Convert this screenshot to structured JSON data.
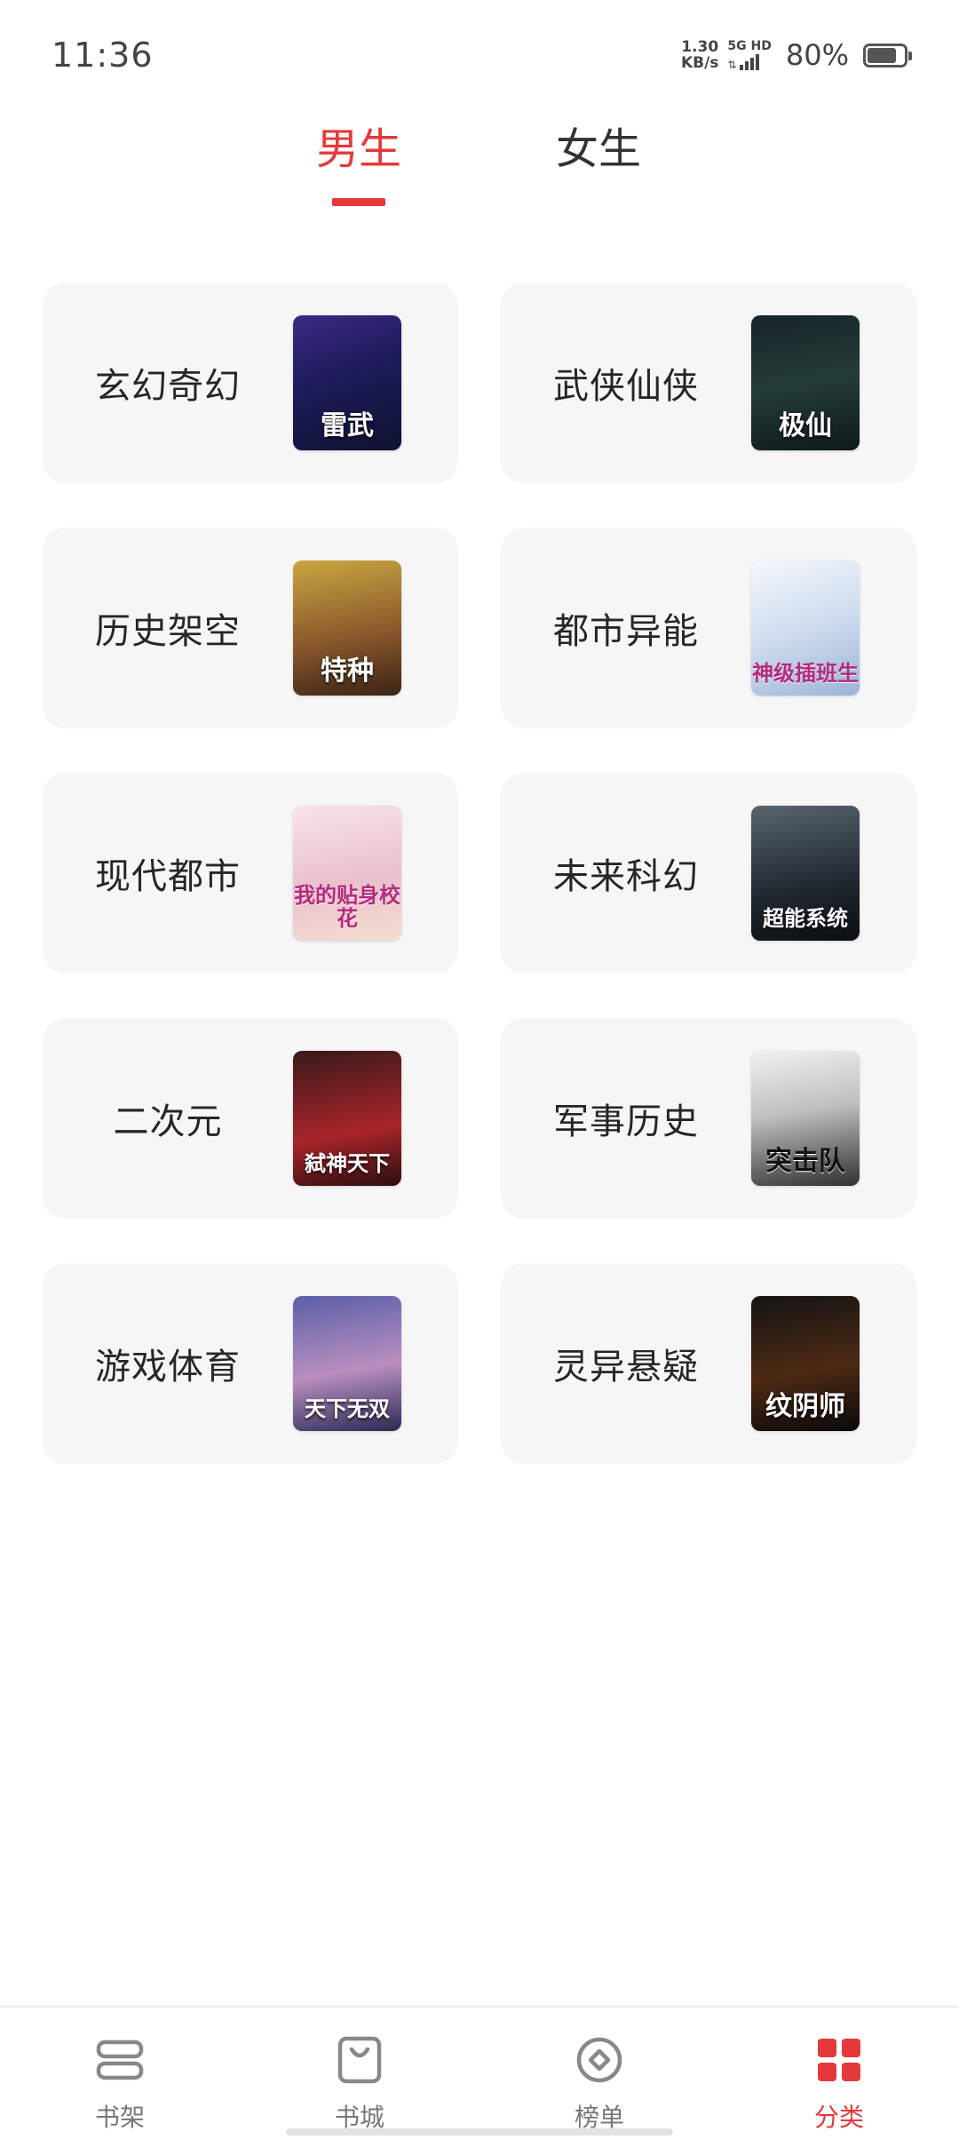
{
  "status_bar": {
    "time": "11:36",
    "net_speed_value": "1.30",
    "net_speed_unit": "KB/s",
    "network_tags": "5G HD",
    "arrows": "⇅",
    "battery_percent": "80%",
    "battery_level": 0.8,
    "icons": [
      "signal-icon",
      "battery-icon"
    ]
  },
  "gender_tabs": [
    {
      "label": "男生",
      "active": true
    },
    {
      "label": "女生",
      "active": false
    }
  ],
  "categories": [
    {
      "name": "玄幻奇幻",
      "cover_text": "雷武",
      "cover_icon": "book-cover"
    },
    {
      "name": "武侠仙侠",
      "cover_text": "极仙",
      "cover_icon": "book-cover"
    },
    {
      "name": "历史架空",
      "cover_text": "特种",
      "cover_icon": "book-cover"
    },
    {
      "name": "都市异能",
      "cover_text": "神级插班生",
      "cover_icon": "book-cover"
    },
    {
      "name": "现代都市",
      "cover_text": "我的贴身校花",
      "cover_icon": "book-cover"
    },
    {
      "name": "未来科幻",
      "cover_text": "超能系统",
      "cover_icon": "book-cover"
    },
    {
      "name": "二次元",
      "cover_text": "弑神天下",
      "cover_icon": "book-cover"
    },
    {
      "name": "军事历史",
      "cover_text": "突击队",
      "cover_icon": "book-cover"
    },
    {
      "name": "游戏体育",
      "cover_text": "天下无双",
      "cover_icon": "book-cover"
    },
    {
      "name": "灵异悬疑",
      "cover_text": "纹阴师",
      "cover_icon": "book-cover"
    }
  ],
  "bottom_nav": [
    {
      "label": "书架",
      "icon": "bookshelf-icon",
      "active": false
    },
    {
      "label": "书城",
      "icon": "store-bag-icon",
      "active": false
    },
    {
      "label": "榜单",
      "icon": "ranking-icon",
      "active": false
    },
    {
      "label": "分类",
      "icon": "category-grid-icon",
      "active": true
    }
  ],
  "colors": {
    "accent": "#e5383b",
    "card_bg": "#f6f6f7",
    "text": "#262626",
    "inactive_nav": "#777777"
  }
}
